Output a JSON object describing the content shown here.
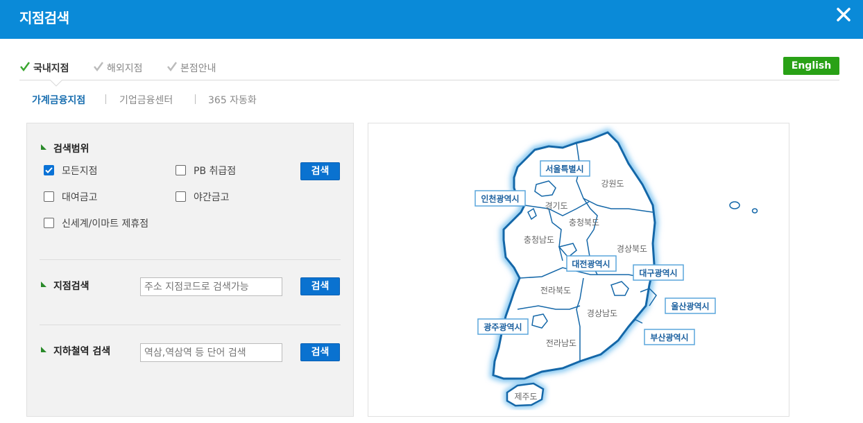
{
  "header": {
    "title": "지점검색"
  },
  "tabs": [
    {
      "label": "국내지점",
      "active": true
    },
    {
      "label": "해외지점",
      "active": false
    },
    {
      "label": "본점안내",
      "active": false
    }
  ],
  "english_label": "English",
  "subtabs": [
    {
      "label": "가계금융지점",
      "active": true
    },
    {
      "label": "기업금융센터",
      "active": false
    },
    {
      "label": "365 자동화",
      "active": false
    }
  ],
  "search_scope": {
    "title": "검색범위",
    "options": [
      {
        "label": "모든지점",
        "checked": true
      },
      {
        "label": "PB 취급점",
        "checked": false
      },
      {
        "label": "대여금고",
        "checked": false
      },
      {
        "label": "야간금고",
        "checked": false
      },
      {
        "label": "신세계/이마트 제휴점",
        "checked": false
      }
    ],
    "button": "검색"
  },
  "branch_search": {
    "title": "지점검색",
    "placeholder": "주소 지점코드로 검색가능",
    "button": "검색"
  },
  "subway_search": {
    "title": "지하철역 검색",
    "placeholder": "역삼,역삼역 등 단어 검색",
    "button": "검색"
  },
  "map": {
    "regions": [
      "강원도",
      "경기도",
      "충청북도",
      "충청남도",
      "경상북도",
      "전라북도",
      "경상남도",
      "전라남도",
      "제주도"
    ],
    "cities": [
      "서울특별시",
      "인천광역시",
      "대전광역시",
      "대구광역시",
      "울산광역시",
      "광주광역시",
      "부산광역시"
    ]
  },
  "colors": {
    "header": "#0a8ad8",
    "accent_blue": "#0a72d0",
    "english_green": "#29a116",
    "map_outline": "#1467a8"
  }
}
